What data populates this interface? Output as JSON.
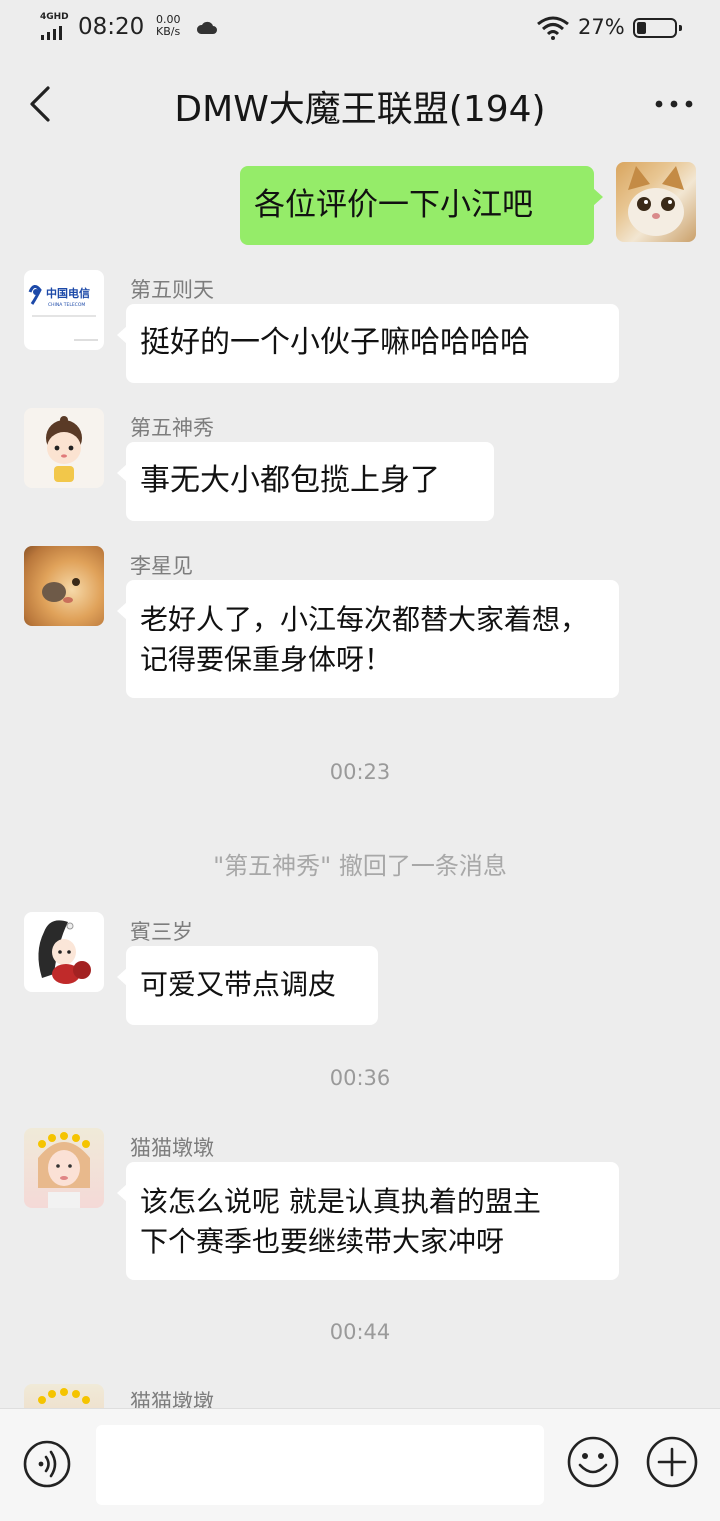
{
  "status_bar": {
    "network": "4GHD",
    "time": "08:20",
    "speed_value": "0.00",
    "speed_unit": "KB/s",
    "battery": "27%",
    "battery_level": 0.27
  },
  "header": {
    "title": "DMW大魔王联盟(194)"
  },
  "messages": [
    {
      "sender": "",
      "side": "out",
      "lines": [
        "各位评价一下小江吧"
      ]
    },
    {
      "sender": "第五则天",
      "side": "in",
      "lines": [
        "挺好的一个小伙子嘛哈哈哈哈"
      ]
    },
    {
      "sender": "第五神秀",
      "side": "in",
      "lines": [
        "事无大小都包揽上身了"
      ]
    },
    {
      "sender": "李星见",
      "side": "in",
      "lines": [
        "老好人了，小江每次都替大家着想，",
        "记得要保重身体呀！"
      ]
    },
    {
      "sender": "賓三岁",
      "side": "in",
      "lines": [
        "可爱又带点调皮"
      ]
    },
    {
      "sender": "猫猫墩墩",
      "side": "in",
      "lines": [
        "该怎么说呢  就是认真执着的盟主",
        "下个赛季也要继续带大家冲呀"
      ]
    },
    {
      "sender": "猫猫墩墩",
      "side": "in",
      "lines": []
    }
  ],
  "timestamps": [
    "00:23",
    "00:36",
    "00:44"
  ],
  "system_notice": "\"第五神秀\" 撤回了一条消息",
  "avatar_logo": {
    "brand_cn": "中国电信",
    "brand_en": "CHINA TELECOM"
  },
  "input_bar": {
    "value": "",
    "placeholder": ""
  },
  "colors": {
    "background": "#ededed",
    "outgoing_bubble": "#95ec69",
    "incoming_bubble": "#ffffff"
  }
}
